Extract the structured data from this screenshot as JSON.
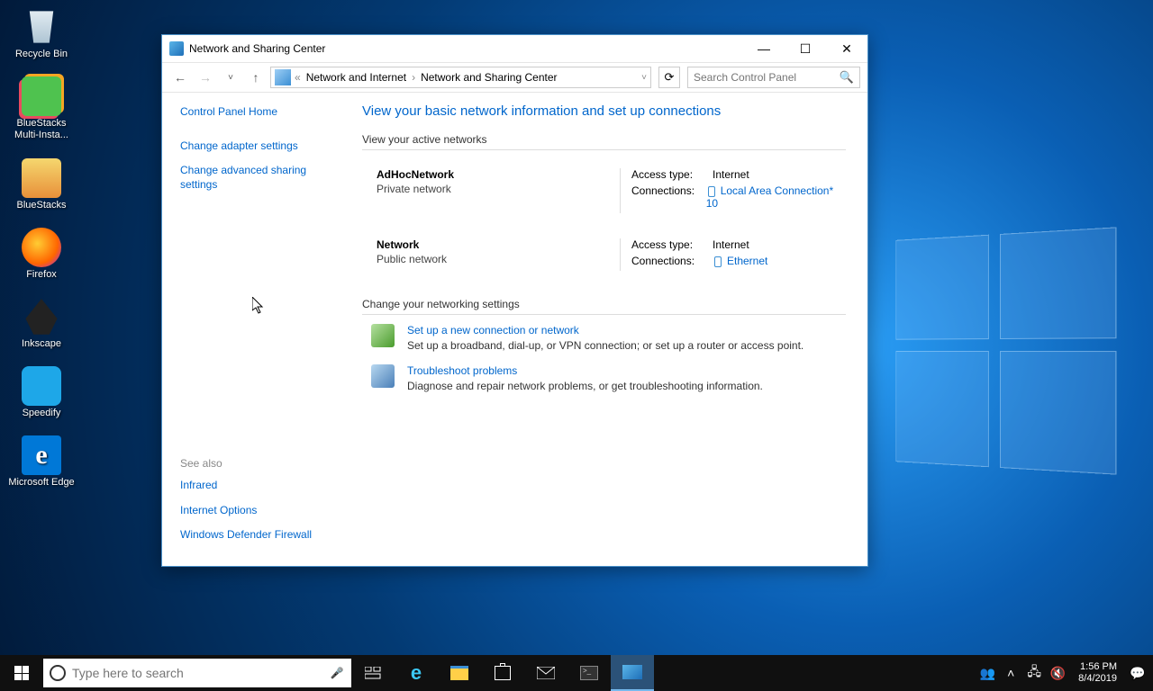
{
  "desktop": {
    "icons": [
      {
        "label": "Recycle Bin",
        "color": "#e8f0f5"
      },
      {
        "label": "BlueStacks Multi-Insta...",
        "color": "#4fc24f"
      },
      {
        "label": "BlueStacks",
        "color": "#f5a623"
      },
      {
        "label": "Firefox",
        "color": "#ff7a1a"
      },
      {
        "label": "Inkscape",
        "color": "#333333"
      },
      {
        "label": "Speedify",
        "color": "#1ea7e8"
      },
      {
        "label": "Microsoft Edge",
        "color": "#0078d7"
      }
    ]
  },
  "window": {
    "title": "Network and Sharing Center",
    "breadcrumb": {
      "prefix": "«",
      "items": [
        "Network and Internet",
        "Network and Sharing Center"
      ]
    },
    "search_placeholder": "Search Control Panel",
    "left": {
      "home": "Control Panel Home",
      "links": [
        "Change adapter settings",
        "Change advanced sharing settings"
      ],
      "seealso_label": "See also",
      "seealso": [
        "Infrared",
        "Internet Options",
        "Windows Defender Firewall"
      ]
    },
    "main": {
      "heading": "View your basic network information and set up connections",
      "active_hdr": "View your active networks",
      "networks": [
        {
          "name": "AdHocNetwork",
          "type": "Private network",
          "access_k": "Access type:",
          "access_v": "Internet",
          "conn_k": "Connections:",
          "conn_v": "Local Area Connection* 10"
        },
        {
          "name": "Network",
          "type": "Public network",
          "access_k": "Access type:",
          "access_v": "Internet",
          "conn_k": "Connections:",
          "conn_v": "Ethernet"
        }
      ],
      "change_hdr": "Change your networking settings",
      "options": [
        {
          "title": "Set up a new connection or network",
          "desc": "Set up a broadband, dial-up, or VPN connection; or set up a router or access point."
        },
        {
          "title": "Troubleshoot problems",
          "desc": "Diagnose and repair network problems, or get troubleshooting information."
        }
      ]
    }
  },
  "taskbar": {
    "search_placeholder": "Type here to search",
    "time": "1:56 PM",
    "date": "8/4/2019"
  }
}
